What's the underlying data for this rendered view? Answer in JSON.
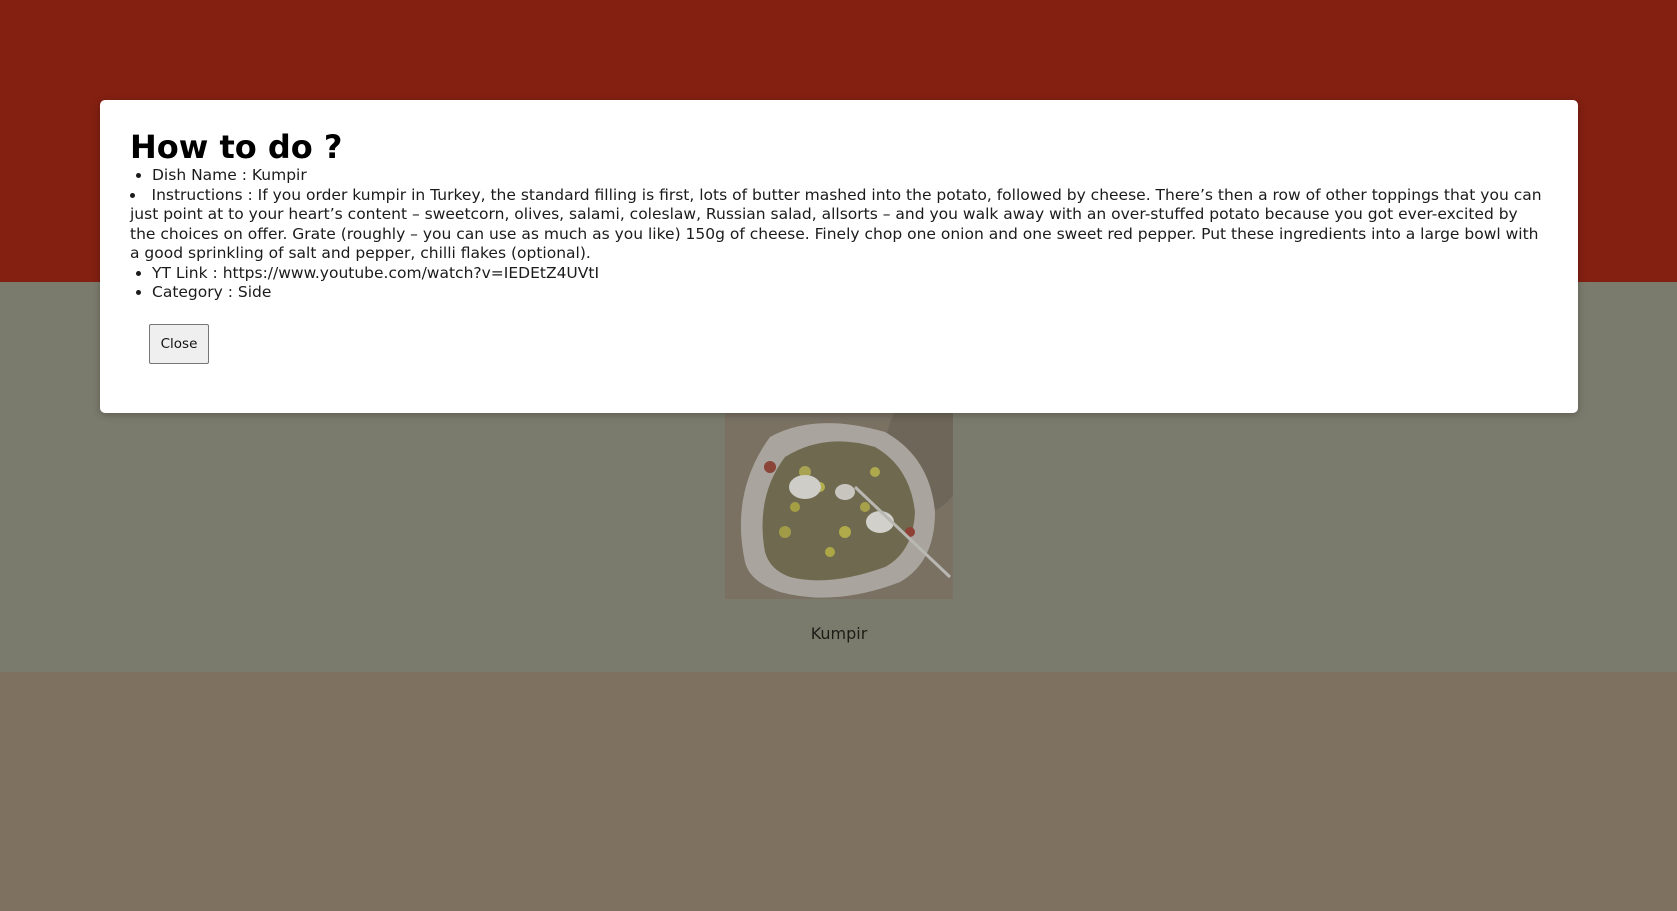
{
  "modal": {
    "title": "How to do ?",
    "details": [
      {
        "label": "Dish Name",
        "separator": " : ",
        "value": "Kumpir"
      },
      {
        "label": "Instructions",
        "separator": " : ",
        "value": "If you order kumpir in Turkey, the standard filling is first, lots of butter mashed into the potato, followed by cheese. There’s then a row of other toppings that you can just point at to your heart’s content – sweetcorn, olives, salami, coleslaw, Russian salad, allsorts – and you walk away with an over-stuffed potato because you got ever-excited by the choices on offer. Grate (roughly – you can use as much as you like) 150g of cheese. Finely chop one onion and one sweet red pepper. Put these ingredients into a large bowl with a good sprinkling of salt and pepper, chilli flakes (optional)."
      },
      {
        "label": "YT Link",
        "separator": " : ",
        "value": "https://www.youtube.com/watch?v=IEDEtZ4UVtI"
      },
      {
        "label": "Category",
        "separator": " : ",
        "value": "Side"
      }
    ],
    "close_label": "Close"
  },
  "meal_card": {
    "name": "Kumpir",
    "image_icon": "meal-photo"
  },
  "colors": {
    "top_band": "#832012",
    "middle_band": "#7b7b6d",
    "bottom_band": "#7f7160",
    "modal_background": "#ffffff"
  }
}
